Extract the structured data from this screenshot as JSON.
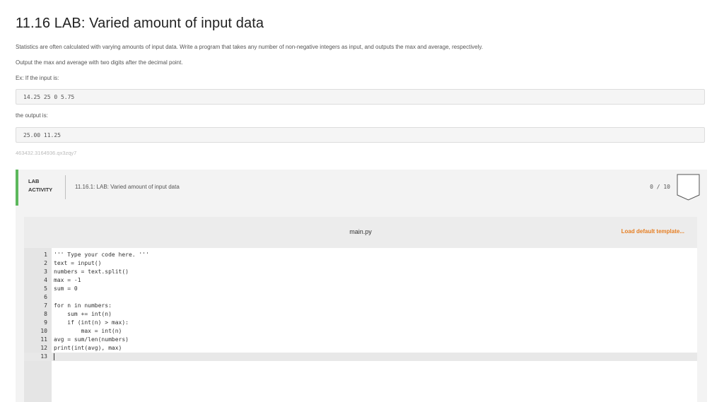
{
  "page": {
    "title": "11.16 LAB: Varied amount of input data",
    "para1": "Statistics are often calculated with varying amounts of input data. Write a program that takes any number of non-negative integers as input, and outputs the max and average, respectively.",
    "para2": "Output the max and average with two digits after the decimal point.",
    "para3": "Ex: If the input is:",
    "example_input": "14.25 25 0 5.75",
    "para4": "the output is:",
    "example_output": "25.00 11.25",
    "lab_id": "463432.3164936.qx3zqy7"
  },
  "lab": {
    "label_line1": "LAB",
    "label_line2": "ACTIVITY",
    "name": "11.16.1: LAB: Varied amount of input data",
    "score": "0 / 10"
  },
  "editor": {
    "filename": "main.py",
    "load_default": "Load default template...",
    "lines": [
      {
        "n": "1",
        "text": "''' Type your code here. '''"
      },
      {
        "n": "2",
        "text": "text = input()"
      },
      {
        "n": "3",
        "text": "numbers = text.split()"
      },
      {
        "n": "4",
        "text": "max = -1"
      },
      {
        "n": "5",
        "text": "sum = 0"
      },
      {
        "n": "6",
        "text": ""
      },
      {
        "n": "7",
        "text": "for n in numbers:"
      },
      {
        "n": "8",
        "text": "    sum += int(n)"
      },
      {
        "n": "9",
        "text": "    if (int(n) > max):"
      },
      {
        "n": "10",
        "text": "        max = int(n)"
      },
      {
        "n": "11",
        "text": "avg = sum/len(numbers)"
      },
      {
        "n": "12",
        "text": "print(int(avg), max)"
      },
      {
        "n": "13",
        "text": ""
      }
    ]
  }
}
